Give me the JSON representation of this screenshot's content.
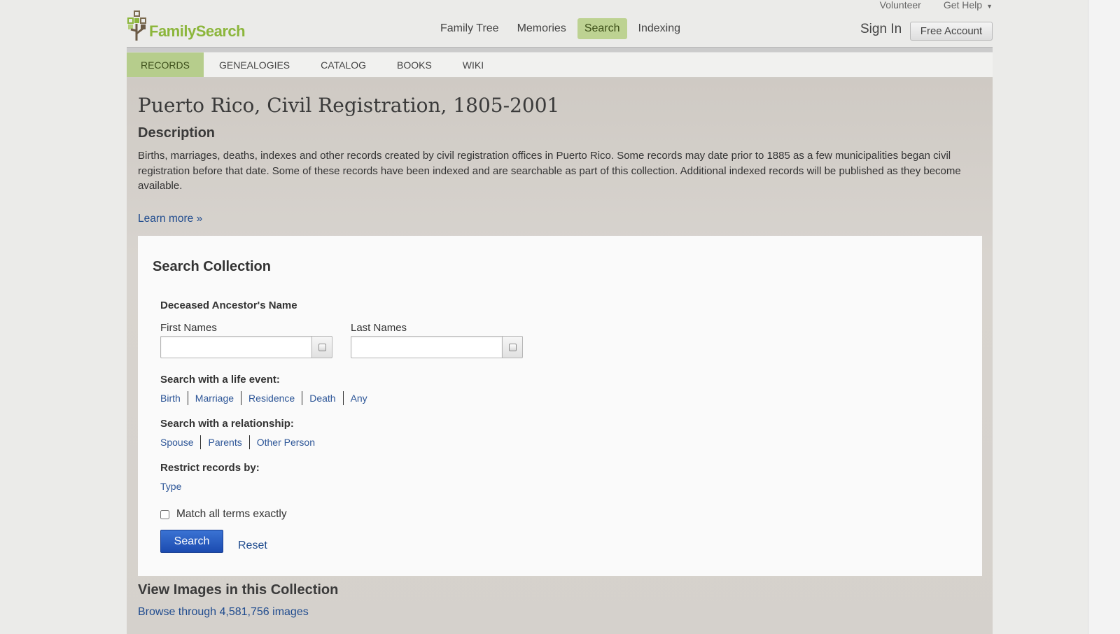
{
  "header": {
    "logo_text": "FamilySearch",
    "util_links": [
      "Volunteer",
      "Get Help"
    ],
    "main_nav": [
      "Family Tree",
      "Memories",
      "Search",
      "Indexing"
    ],
    "active_nav": "Search",
    "sign_in": "Sign In",
    "free_account": "Free Account"
  },
  "sub_nav": {
    "tabs": [
      "RECORDS",
      "GENEALOGIES",
      "CATALOG",
      "BOOKS",
      "WIKI"
    ],
    "active": "RECORDS"
  },
  "collection": {
    "title": "Puerto Rico, Civil Registration, 1805-2001",
    "description_heading": "Description",
    "description": "Births, marriages, deaths, indexes and other records created by civil registration offices in Puerto Rico. Some records may date prior to 1885 as a few municipalities began civil registration before that date. Some of these records have been indexed and are searchable as part of this collection. Additional indexed records will be published as they become available.",
    "learn_more": "Learn more »"
  },
  "search": {
    "title": "Search Collection",
    "name_heading": "Deceased Ancestor's Name",
    "first_names_label": "First Names",
    "first_names_value": "",
    "last_names_label": "Last Names",
    "last_names_value": "",
    "life_event_label": "Search with a life event:",
    "life_events": [
      "Birth",
      "Marriage",
      "Residence",
      "Death",
      "Any"
    ],
    "relationship_label": "Search with a relationship:",
    "relationships": [
      "Spouse",
      "Parents",
      "Other Person"
    ],
    "restrict_label": "Restrict records by:",
    "restrict_link": "Type",
    "match_exact_label": "Match all terms exactly",
    "match_exact_checked": false,
    "search_button": "Search",
    "reset_link": "Reset"
  },
  "images": {
    "heading": "View Images in this Collection",
    "browse_link": "Browse through 4,581,756 images"
  },
  "colors": {
    "brand_green": "#8cb63c",
    "active_tab": "#b6cd8c",
    "link_blue": "#1f4b8e",
    "button_blue": "#2a5dc2"
  }
}
